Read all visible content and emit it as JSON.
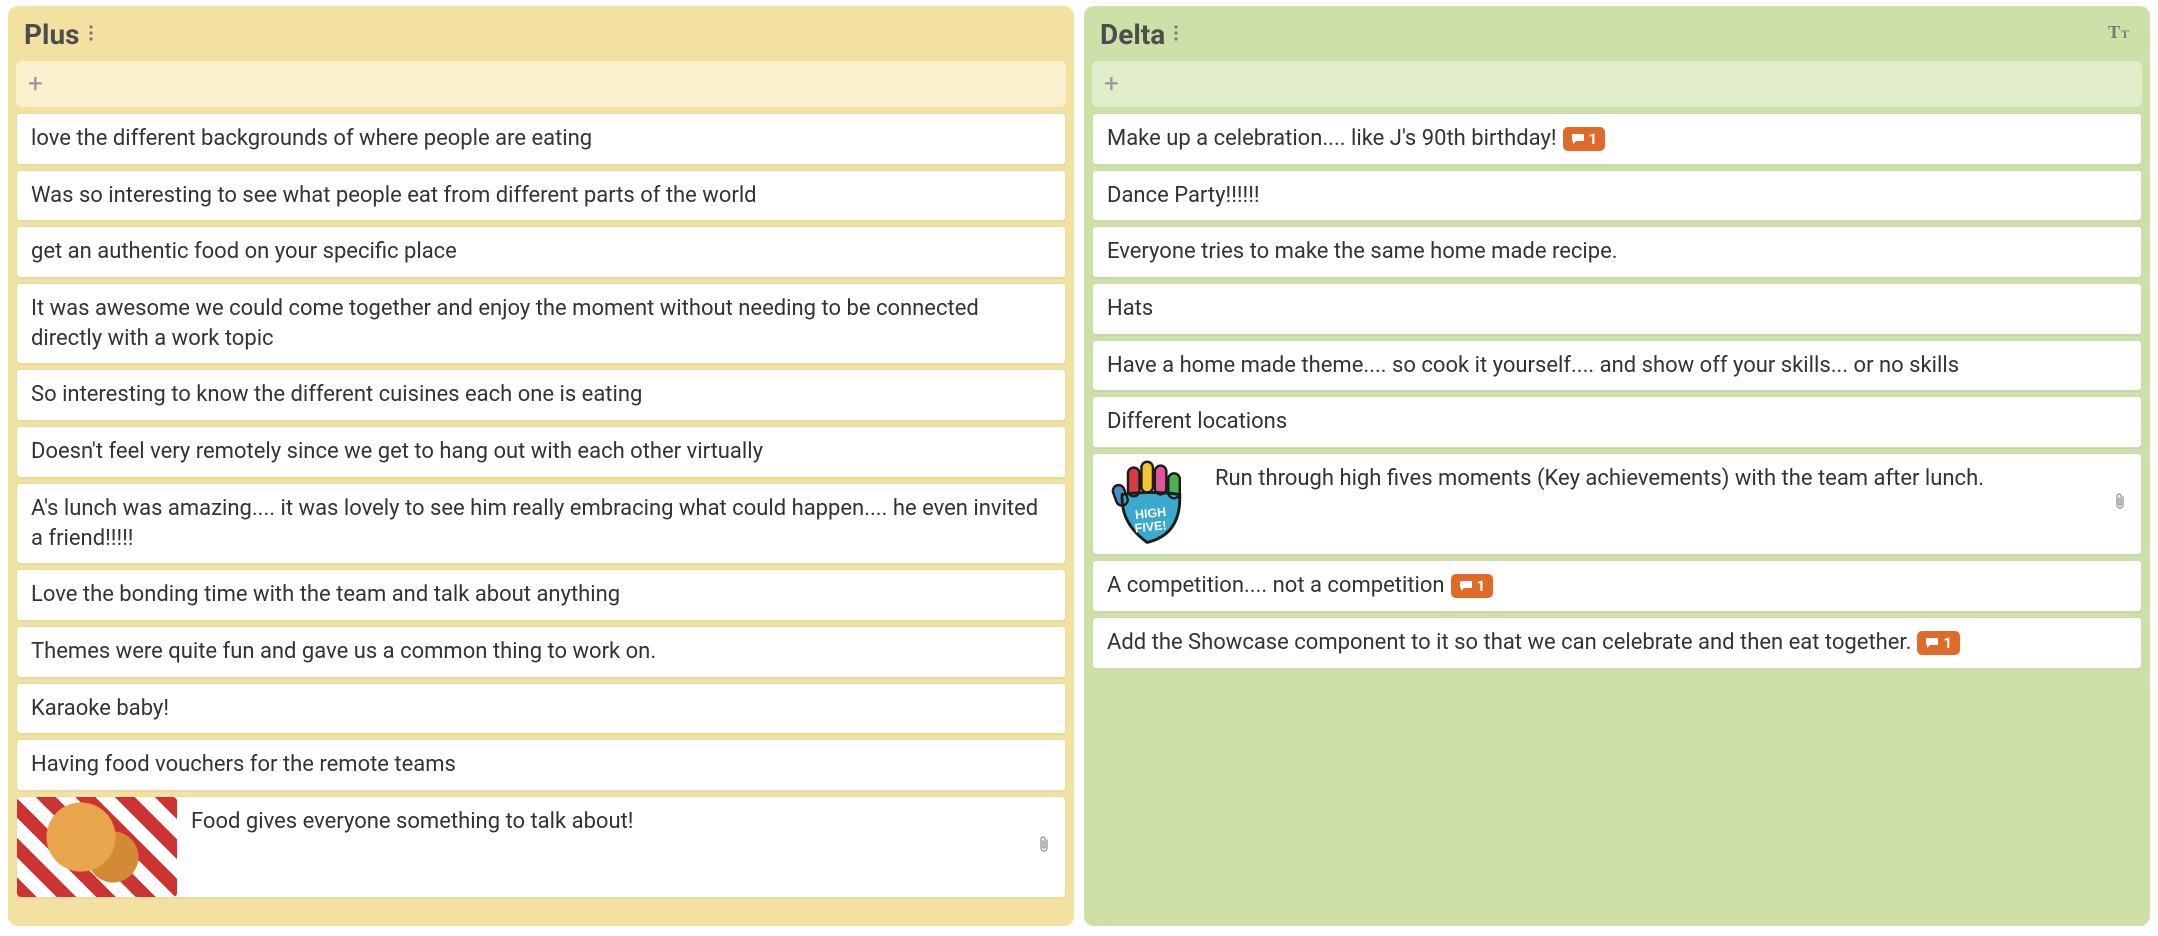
{
  "columns": [
    {
      "key": "plus",
      "title": "Plus",
      "theme": "col-plus",
      "showTextTool": false,
      "cards": [
        {
          "text": "love the different backgrounds of where people are eating"
        },
        {
          "text": "Was so interesting to see what people eat from different parts of the world"
        },
        {
          "text": "get an authentic food on your specific place"
        },
        {
          "text": "It was awesome we could come together and enjoy the moment without needing to be connected directly with a work topic"
        },
        {
          "text": "So interesting to know the different cuisines each one is eating"
        },
        {
          "text": "Doesn't feel very remotely since we get to hang out with each other virtually"
        },
        {
          "text": "A's lunch was amazing.... it was lovely to see him really embracing what could happen.... he even invited a friend!!!!!"
        },
        {
          "text": "Love the bonding time with the team and talk about anything"
        },
        {
          "text": "Themes were quite fun and gave us a common thing to work on."
        },
        {
          "text": "Karaoke baby!"
        },
        {
          "text": "Having food vouchers for the remote teams"
        },
        {
          "text": "Food gives everyone something to talk about!",
          "thumb": "food",
          "attachment": true
        }
      ]
    },
    {
      "key": "delta",
      "title": "Delta",
      "theme": "col-delta",
      "showTextTool": true,
      "cards": [
        {
          "text": "Make up a celebration.... like J's 90th birthday!",
          "comments": 1
        },
        {
          "text": "Dance Party!!!!!!"
        },
        {
          "text": "Everyone tries to make the same home made recipe."
        },
        {
          "text": "Hats"
        },
        {
          "text": "Have a home made theme.... so cook it yourself.... and show off your skills... or no skills"
        },
        {
          "text": "Different locations"
        },
        {
          "text": "Run through high fives moments (Key achievements) with the team after lunch.",
          "thumb": "hand",
          "attachment": true
        },
        {
          "text": "A competition.... not a competition",
          "comments": 1
        },
        {
          "text": "Add the Showcase component to it so that we can celebrate and then eat together.",
          "comments": 1
        }
      ]
    }
  ]
}
